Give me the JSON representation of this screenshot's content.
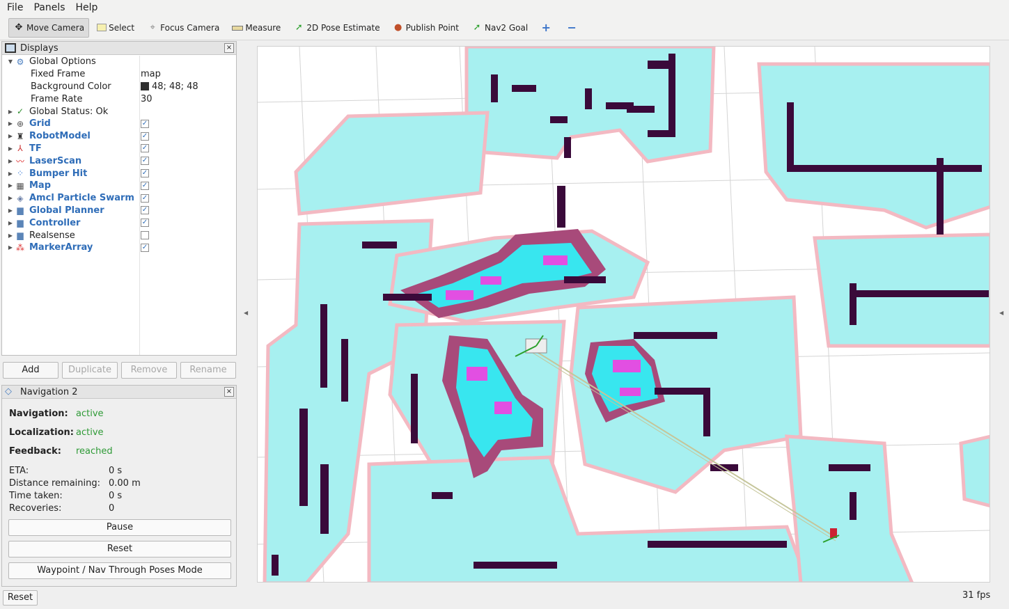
{
  "menu": {
    "file": "File",
    "panels": "Panels",
    "help": "Help"
  },
  "toolbar": {
    "move_camera": "Move Camera",
    "select": "Select",
    "focus_camera": "Focus Camera",
    "measure": "Measure",
    "pose_estimate": "2D Pose Estimate",
    "publish_point": "Publish Point",
    "nav2_goal": "Nav2 Goal"
  },
  "displays": {
    "title": "Displays",
    "close": "×",
    "global_options": "Global Options",
    "fixed_frame_label": "Fixed Frame",
    "fixed_frame_value": "map",
    "bg_color_label": "Background Color",
    "bg_color_value": "48; 48; 48",
    "frame_rate_label": "Frame Rate",
    "frame_rate_value": "30",
    "global_status": "Global Status: Ok",
    "items": [
      {
        "label": "Grid",
        "checked": true
      },
      {
        "label": "RobotModel",
        "checked": true
      },
      {
        "label": "TF",
        "checked": true
      },
      {
        "label": "LaserScan",
        "checked": true
      },
      {
        "label": "Bumper Hit",
        "checked": true
      },
      {
        "label": "Map",
        "checked": true
      },
      {
        "label": "Amcl Particle Swarm",
        "checked": true
      },
      {
        "label": "Global Planner",
        "checked": true
      },
      {
        "label": "Controller",
        "checked": true
      },
      {
        "label": "Realsense",
        "checked": false
      },
      {
        "label": "MarkerArray",
        "checked": true
      }
    ],
    "buttons": {
      "add": "Add",
      "duplicate": "Duplicate",
      "remove": "Remove",
      "rename": "Rename"
    }
  },
  "nav2": {
    "title": "Navigation 2",
    "close": "×",
    "navigation_label": "Navigation:",
    "navigation_value": "active",
    "localization_label": "Localization:",
    "localization_value": "active",
    "feedback_label": "Feedback:",
    "feedback_value": "reached",
    "eta_label": "ETA:",
    "eta_value": "0 s",
    "distance_label": "Distance remaining:",
    "distance_value": "0.00 m",
    "time_label": "Time taken:",
    "time_value": "0 s",
    "recoveries_label": "Recoveries:",
    "recoveries_value": "0",
    "pause": "Pause",
    "reset": "Reset",
    "waypoint": "Waypoint / Nav Through Poses Mode"
  },
  "footer": {
    "reset": "Reset",
    "fps": "31 fps"
  },
  "colors": {
    "inflation": "#a7f0f0",
    "obstacle": "#3a0a3a",
    "costmap_edge": "#f3b9c2",
    "link": "#2f6db8",
    "active": "#2e9a36"
  }
}
